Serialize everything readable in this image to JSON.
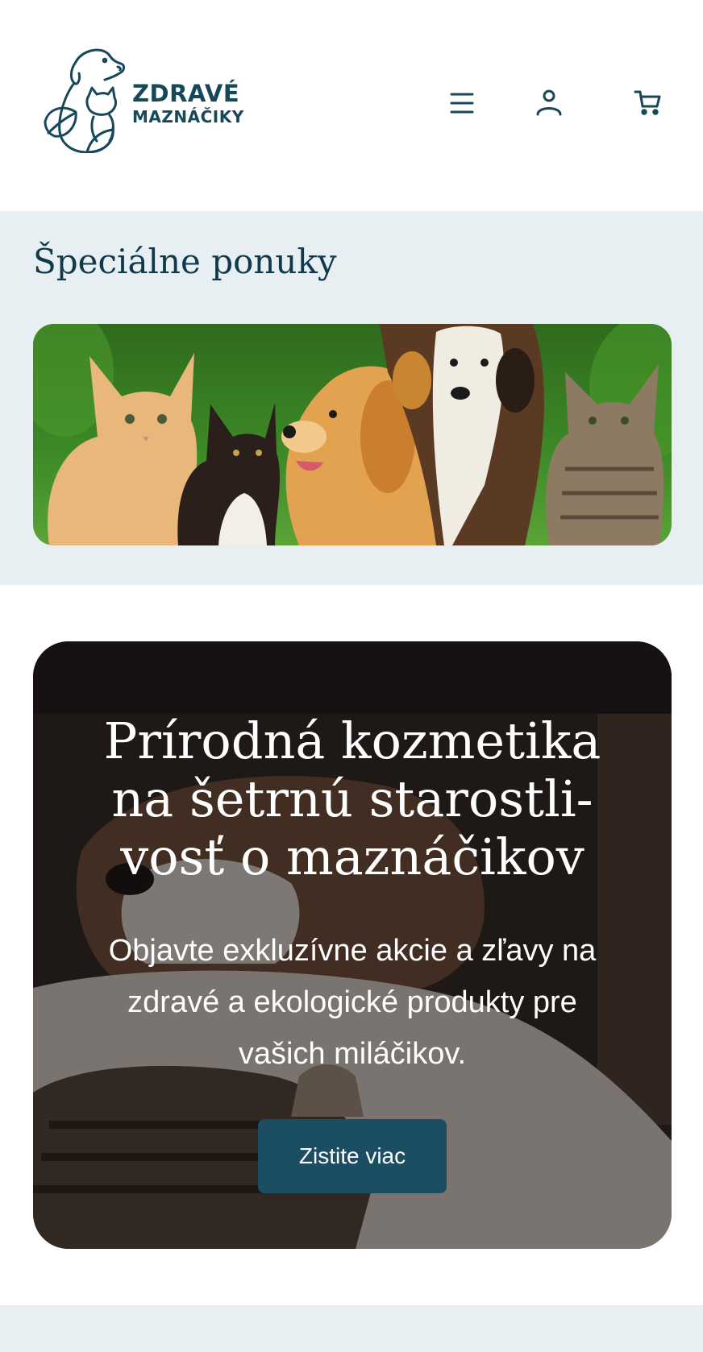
{
  "header": {
    "logo": {
      "line1": "ZDRAVÉ",
      "line2": "MAZNÁČIKY"
    },
    "icons": {
      "menu": "hamburger-menu-icon",
      "account": "user-icon",
      "cart": "shopping-cart-icon"
    }
  },
  "specials": {
    "title": "Špeciálne ponuky"
  },
  "hero": {
    "title": "Prírodná kozmetika na šetrnú starostli-vosť o maznáčikov",
    "title_lines": [
      "Prírodná kozmetika",
      "na šetrnú starostli-",
      "vosť o maznáčikov"
    ],
    "subtitle_lines": [
      "Objavte exkluzívne akcie a zľavy na",
      "zdravé a ekologické produkty pre",
      "vašich miláčikov."
    ],
    "button_label": "Zistite viac"
  },
  "colors": {
    "brand": "#16485a",
    "section_bg": "#e8eff2",
    "button_bg": "#1b4e62"
  }
}
